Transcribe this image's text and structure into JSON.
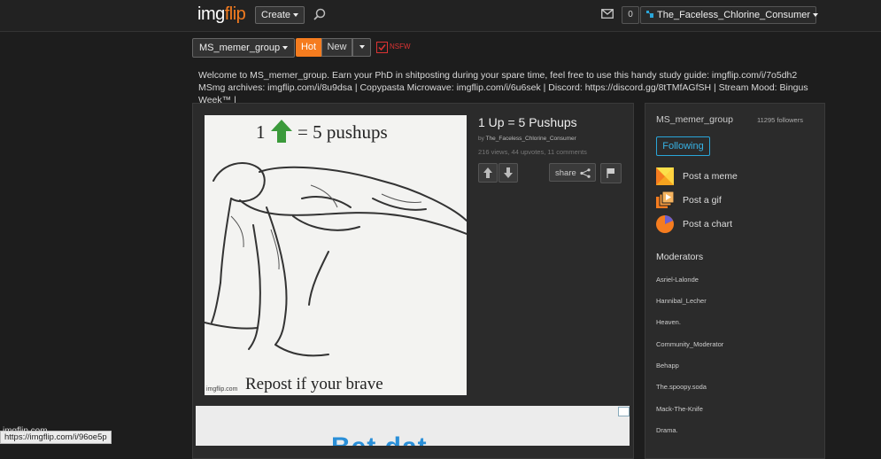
{
  "header": {
    "logo_main": "img",
    "logo_accent": "flip",
    "create_label": "Create",
    "notification_count": "0",
    "username": "The_Faceless_Chlorine_Consumer"
  },
  "controls": {
    "stream_select": "MS_memer_group",
    "sort_hot": "Hot",
    "sort_new": "New",
    "nsfw_label": "NSFW"
  },
  "welcome_text": "Welcome to MS_memer_group. Earn your PhD in shitposting during your spare time, feel free to use this handy study guide: imgflip.com/i/7o5dh2 MSmg archives: imgflip.com/i/8u9dsa | Copypasta Microwave: imgflip.com/i/6u6sek | Discord: https://discord.gg/8tTMfAGfSH | Stream Mood: Bingus Week™ |",
  "post": {
    "meme_top_prefix": "1",
    "meme_top_suffix": "= 5 pushups",
    "meme_bottom": "Repost if your brave",
    "meme_watermark": "imgflip.com",
    "title": "1 Up = 5 Pushups",
    "by_prefix": "by",
    "author": "The_Faceless_Chlorine_Consumer",
    "stats": "216 views, 44 upvotes, 11 comments",
    "share_label": "share"
  },
  "ad": {
    "text": "Bet dat..."
  },
  "sidebar": {
    "stream_name": "MS_memer_group",
    "followers": "11295 followers",
    "follow_label": "Following",
    "actions": {
      "meme": "Post a meme",
      "gif": "Post a gif",
      "chart": "Post a chart"
    },
    "moderators_title": "Moderators",
    "moderators": [
      "Asriel-Lalonde",
      "Hannibal_Lecher",
      "Heaven.",
      "Community_Moderator",
      "Behapp",
      "The.spoopy.soda",
      "Mack-The-Knife",
      "Drama."
    ]
  },
  "status": {
    "url": "https://imgflip.com/i/96oe5p",
    "overlay": "imgflip.com"
  },
  "colors": {
    "accent": "#f57c1f",
    "follow": "#37b3e6",
    "nsfw": "#dd3333",
    "upvote_arrow": "#3b9a3b"
  },
  "icons": [
    "search-icon",
    "mail-icon",
    "user-icon",
    "caret-down-icon",
    "upvote-icon",
    "downvote-icon",
    "share-icon",
    "flag-icon",
    "meme-icon",
    "gif-icon",
    "chart-icon",
    "ad-choices-icon"
  ]
}
